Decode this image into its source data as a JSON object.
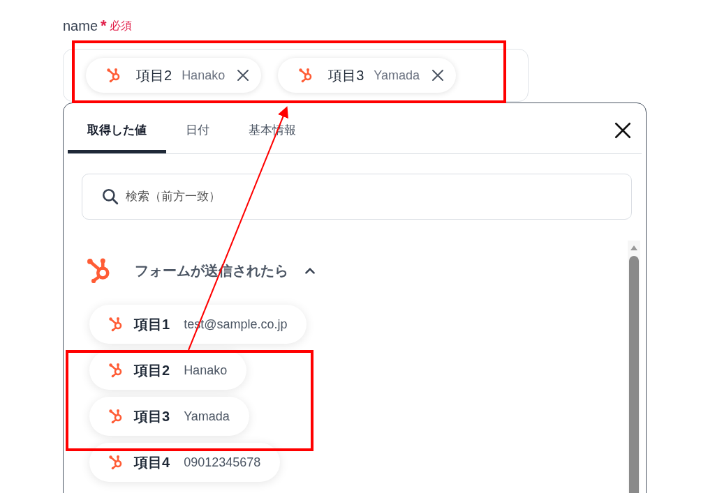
{
  "field": {
    "label": "name",
    "required_mark": "*",
    "required_text": "必須",
    "chips": [
      {
        "label": "項目2",
        "value": "Hanako"
      },
      {
        "label": "項目3",
        "value": "Yamada"
      }
    ]
  },
  "panel": {
    "tabs": [
      {
        "label": "取得した値",
        "selected": true
      },
      {
        "label": "日付",
        "selected": false
      },
      {
        "label": "基本情報",
        "selected": false
      }
    ],
    "search": {
      "placeholder": "検索（前方一致）"
    },
    "section": {
      "title": "フォームが送信されたら",
      "expanded": true,
      "items": [
        {
          "label": "項目1",
          "value": "test@sample.co.jp"
        },
        {
          "label": "項目2",
          "value": "Hanako"
        },
        {
          "label": "項目3",
          "value": "Yamada"
        },
        {
          "label": "項目4",
          "value": "09012345678"
        }
      ]
    }
  }
}
